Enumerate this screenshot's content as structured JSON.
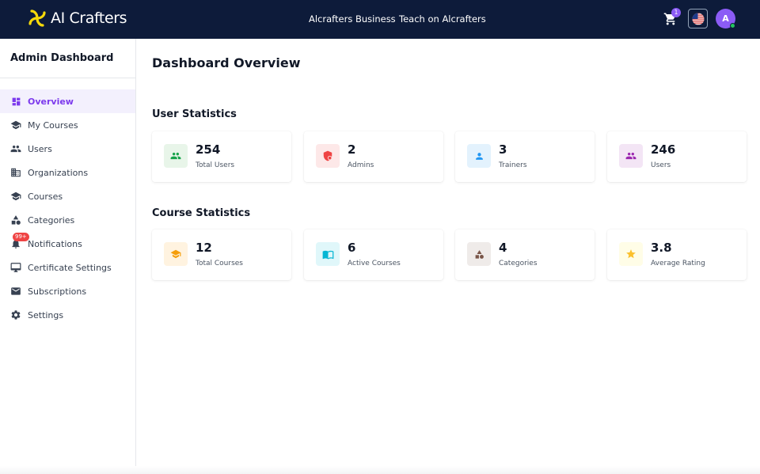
{
  "header": {
    "brand": "AI Crafters",
    "nav": [
      "Alcrafters Business",
      "Teach on Alcrafters"
    ],
    "cart_count": "1",
    "avatar_initial": "A",
    "colors": {
      "bg": "#0d1b3a",
      "accent": "#8b5cf6",
      "logo": "#f5d90a"
    }
  },
  "sidebar": {
    "title": "Admin Dashboard",
    "active": "Overview",
    "notification_badge": "99+",
    "items": [
      {
        "label": "Overview",
        "icon": "dashboard-icon"
      },
      {
        "label": "My Courses",
        "icon": "graduation-cap-icon"
      },
      {
        "label": "Users",
        "icon": "users-icon"
      },
      {
        "label": "Organizations",
        "icon": "building-icon"
      },
      {
        "label": "Courses",
        "icon": "graduation-cap-icon"
      },
      {
        "label": "Categories",
        "icon": "shapes-icon"
      },
      {
        "label": "Notifications",
        "icon": "bell-icon"
      },
      {
        "label": "Certificate Settings",
        "icon": "monitor-icon"
      },
      {
        "label": "Subscriptions",
        "icon": "mail-icon"
      },
      {
        "label": "Settings",
        "icon": "gear-icon"
      }
    ]
  },
  "main": {
    "title": "Dashboard Overview",
    "user_stats": {
      "title": "User Statistics",
      "cards": [
        {
          "value": "254",
          "label": "Total Users",
          "icon": "users-icon",
          "color": "#16a34a",
          "bg": "#e8f5e9"
        },
        {
          "value": "2",
          "label": "Admins",
          "icon": "shield-icon",
          "color": "#ef4444",
          "bg": "#fde8e8"
        },
        {
          "value": "3",
          "label": "Trainers",
          "icon": "person-icon",
          "color": "#2196f3",
          "bg": "#e3f2fd"
        },
        {
          "value": "246",
          "label": "Users",
          "icon": "users-icon",
          "color": "#9c27b0",
          "bg": "#f3e5f5"
        }
      ]
    },
    "course_stats": {
      "title": "Course Statistics",
      "cards": [
        {
          "value": "12",
          "label": "Total Courses",
          "icon": "graduation-cap-icon",
          "color": "#f59e0b",
          "bg": "#fff3e0"
        },
        {
          "value": "6",
          "label": "Active Courses",
          "icon": "book-icon",
          "color": "#06b6d4",
          "bg": "#e0f7fa"
        },
        {
          "value": "4",
          "label": "Categories",
          "icon": "shapes-icon",
          "color": "#795548",
          "bg": "#efebe9"
        },
        {
          "value": "3.8",
          "label": "Average Rating",
          "icon": "star-icon",
          "color": "#fbc02d",
          "bg": "#fffde7"
        }
      ]
    }
  }
}
